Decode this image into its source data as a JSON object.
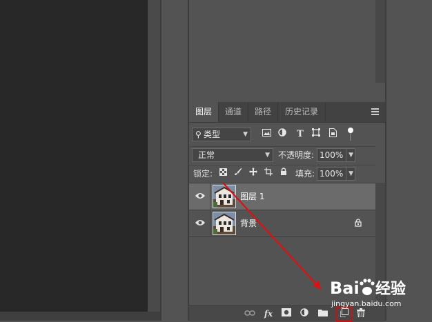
{
  "layers_panel": {
    "tabs": [
      "图层",
      "通道",
      "路径",
      "历史记录"
    ],
    "active_tab": 0,
    "filter_kind": "类型",
    "blend_mode": "正常",
    "opacity_label": "不透明度:",
    "opacity_value": "100%",
    "lock_label": "锁定:",
    "fill_label": "填充:",
    "fill_value": "100%",
    "layers": [
      {
        "name": "图层 1",
        "selected": true,
        "visible": true,
        "locked": false
      },
      {
        "name": "背景",
        "selected": false,
        "visible": true,
        "locked": true
      }
    ],
    "footer_icons": [
      "link-layers-icon",
      "fx-icon",
      "mask-icon",
      "adjustment-icon",
      "group-folder-icon",
      "new-layer-icon",
      "trash-icon"
    ]
  },
  "annotation": {
    "color": "#e01010",
    "target": "new-layer-button"
  },
  "watermark": {
    "logo": "Bai经验",
    "url": "jingyan.baidu.com"
  }
}
